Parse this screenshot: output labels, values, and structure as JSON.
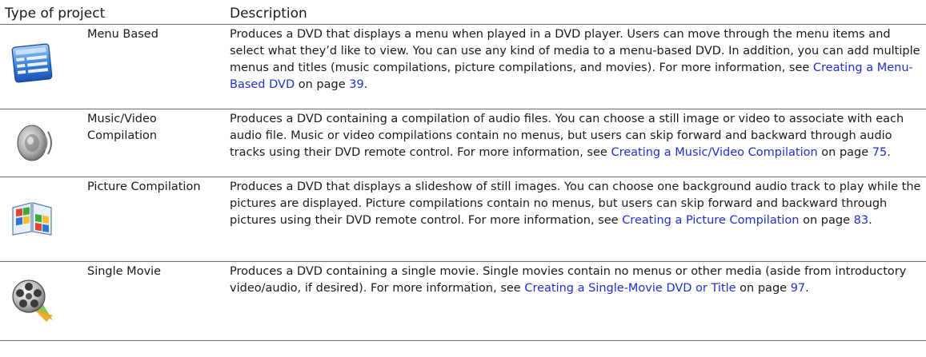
{
  "header": {
    "col_type": "Type of project",
    "col_description": "Description"
  },
  "rows": [
    {
      "icon": "menu-list-icon",
      "type": "Menu Based",
      "desc_before": "Produces a DVD that displays a menu when played in a DVD player. Users can move through the menu items and select what they’d like to view. You can use any kind of media to a menu-based DVD. In addition, you can add multiple menus and titles (music compilations, picture compilations, and movies). For more information, see ",
      "link_text": "Creating a Menu-Based DVD",
      "on_page": " on page ",
      "page": "39",
      "period": "."
    },
    {
      "icon": "speaker-icon",
      "type": "Music/Video Compilation",
      "desc_before": "Produces a DVD containing a compilation of audio files. You can choose a still image or video to associate with each audio file. Music or video compilations contain no menus, but users can skip forward and backward through audio tracks using their DVD remote control. For more information, see ",
      "link_text": "Creating a Music/Video Compilation",
      "on_page": " on page ",
      "page": "75",
      "period": "."
    },
    {
      "icon": "picture-book-icon",
      "type": "Picture Compilation",
      "desc_before": "Produces a DVD that displays a slideshow of still images. You can choose one background audio track to play while the pictures are displayed. Picture compilations contain no menus, but users can skip forward and backward through pictures using their DVD remote control. For more information, see ",
      "link_text": "Creating a Picture Compilation",
      "on_page": " on page ",
      "page": "83",
      "period": "."
    },
    {
      "icon": "film-reel-icon",
      "type": "Single Movie",
      "desc_before": "Produces a DVD containing a single movie. Single movies contain no menus or other media (aside from introductory video/audio, if desired). For more information, see ",
      "link_text": "Creating a Single-Movie DVD or Title",
      "on_page": " on page ",
      "page": "97",
      "period": "."
    }
  ],
  "colors": {
    "link": "#1f2fd0",
    "rule": "#6b6b6b",
    "text": "#1a1a1a"
  }
}
